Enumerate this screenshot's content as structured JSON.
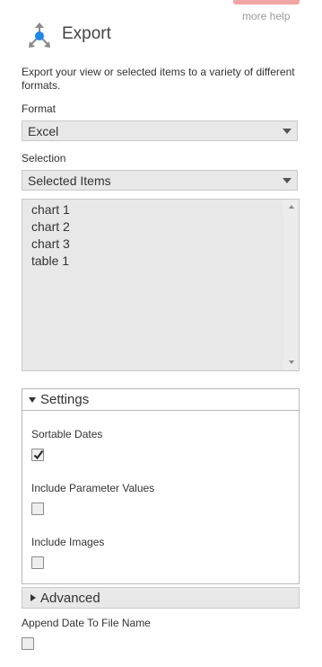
{
  "header": {
    "more_help": "more help",
    "title": "Export",
    "description": "Export your view or selected items to a variety of different formats.",
    "icon": "export-icon"
  },
  "format": {
    "label": "Format",
    "value": "Excel"
  },
  "selection": {
    "label": "Selection",
    "value": "Selected Items"
  },
  "items": [
    "chart 1",
    "chart 2",
    "chart 3",
    "table 1"
  ],
  "settings": {
    "title": "Settings",
    "expanded": true,
    "options": [
      {
        "label": "Sortable Dates",
        "checked": true
      },
      {
        "label": "Include Parameter Values",
        "checked": false
      },
      {
        "label": "Include Images",
        "checked": false
      }
    ]
  },
  "advanced": {
    "title": "Advanced",
    "expanded": false
  },
  "append_date": {
    "label": "Append Date To File Name",
    "checked": false
  },
  "colors": {
    "accent": "#1e88e5",
    "help_bar": "#f3a4a4",
    "field_bg": "#e8e8e8"
  }
}
